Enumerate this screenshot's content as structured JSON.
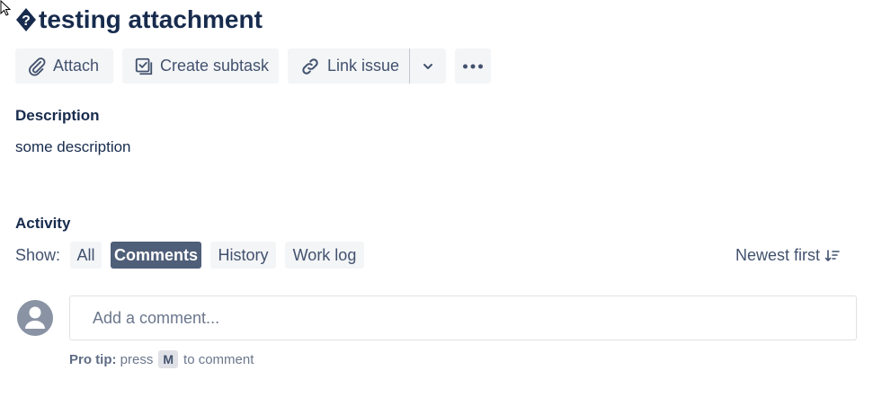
{
  "issue": {
    "title": "testing attachment"
  },
  "toolbar": {
    "attach_label": "Attach",
    "create_subtask_label": "Create subtask",
    "link_issue_label": "Link issue"
  },
  "description": {
    "heading": "Description",
    "text": "some description"
  },
  "activity": {
    "heading": "Activity",
    "show_label": "Show:",
    "filters": [
      "All",
      "Comments",
      "History",
      "Work log"
    ],
    "active_filter": "Comments",
    "sort_label": "Newest first"
  },
  "comment": {
    "placeholder": "Add a comment...",
    "tip_bold": "Pro tip:",
    "tip_press": "press",
    "tip_key": "M",
    "tip_rest": "to comment"
  },
  "colors": {
    "text": "#172b4d",
    "button_bg": "#f4f5f7",
    "active_pill": "#505f79",
    "subtle_text": "#6b778c"
  },
  "icons": [
    "mouse-cursor-icon",
    "unknown-glyph-icon",
    "paperclip-icon",
    "subtask-icon",
    "link-icon",
    "chevron-down-icon",
    "more-icon",
    "sort-icon",
    "avatar-icon"
  ]
}
